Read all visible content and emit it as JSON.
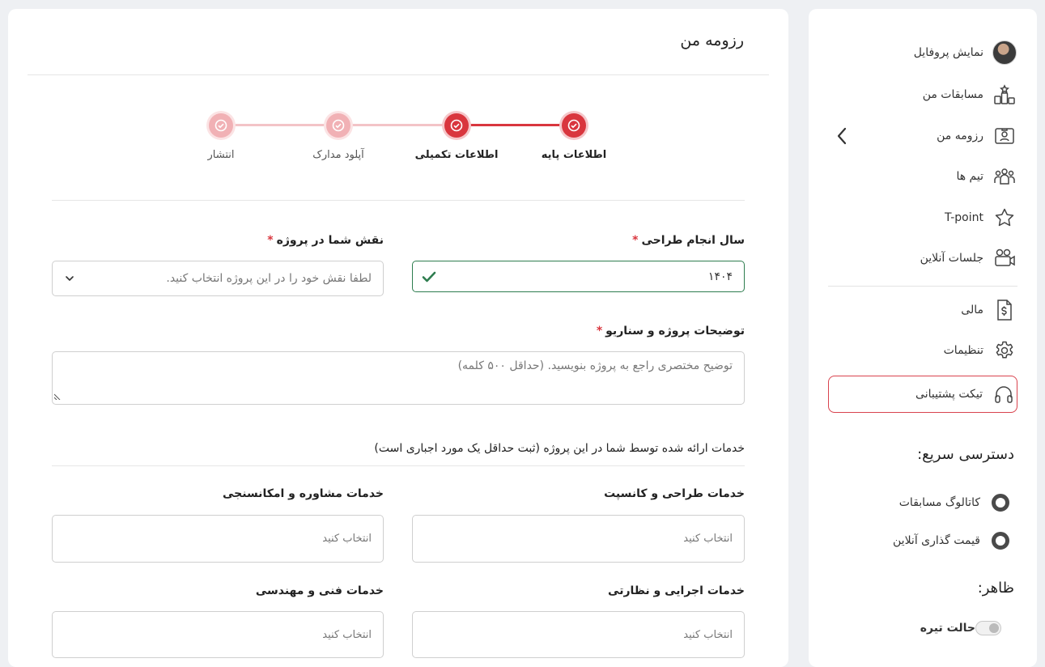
{
  "sidebar": {
    "profile_label": "نمایش پروفایل",
    "items": [
      {
        "label": "مسابقات من",
        "icon": "podium-icon"
      },
      {
        "label": "رزومه من",
        "icon": "resume-icon"
      },
      {
        "label": "تیم ها",
        "icon": "team-icon"
      },
      {
        "label": "T-point",
        "icon": "star-icon"
      },
      {
        "label": "جلسات آنلاین",
        "icon": "video-icon"
      },
      {
        "label": "مالی",
        "icon": "invoice-icon"
      },
      {
        "label": "تنظیمات",
        "icon": "gear-icon"
      },
      {
        "label": "تیکت پشتیبانی",
        "icon": "headphones-icon"
      }
    ],
    "quick_access_title": "دسترسی سریع:",
    "quick_access": [
      {
        "label": "کاتالوگ مسابقات"
      },
      {
        "label": "قیمت گذاری آنلاین"
      }
    ],
    "appearance_title": "ظاهر:",
    "dark_mode_label": "حالت تیره",
    "dark_mode_on": false
  },
  "main": {
    "title": "رزومه من",
    "steps": [
      {
        "label": "اطلاعات پایه",
        "state": "done"
      },
      {
        "label": "اطلاعات تکمیلی",
        "state": "done"
      },
      {
        "label": "آپلود مدارک",
        "state": "todo"
      },
      {
        "label": "انتشار",
        "state": "todo"
      }
    ],
    "year_label": "سال انجام طراحی",
    "year_value": "۱۴۰۴",
    "role_label": "نقش شما در پروژه",
    "role_placeholder": "لطفا نقش خود را در این پروژه انتخاب کنید.",
    "desc_label": "توضیحات پروژه و سناریو",
    "desc_placeholder": "توضیح مختصری راجع به پروژه بنویسید. (حداقل ۵۰۰ کلمه)",
    "required_mark": "*",
    "services_heading": "خدمات ارائه شده توسط شما در این پروژه (ثبت حداقل یک مورد اجباری است)",
    "services": [
      {
        "label": "خدمات طراحی و کانسپت",
        "placeholder": "انتخاب کنید"
      },
      {
        "label": "خدمات مشاوره و امکانسنجی",
        "placeholder": "انتخاب کنید"
      },
      {
        "label": "خدمات اجرایی و نظارتی",
        "placeholder": "انتخاب کنید"
      },
      {
        "label": "خدمات فنی و مهندسی",
        "placeholder": "انتخاب کنید"
      }
    ]
  },
  "colors": {
    "accent": "#d9363e",
    "valid": "#2e7d4f"
  }
}
